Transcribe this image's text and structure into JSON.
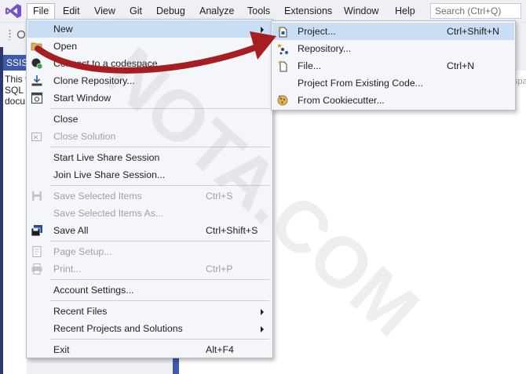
{
  "menubar": {
    "logo_icon": "visual-studio-logo-icon",
    "items": [
      "File",
      "Edit",
      "View",
      "Git",
      "Debug",
      "Analyze",
      "Tools",
      "Extensions",
      "Window",
      "Help"
    ],
    "search": {
      "placeholder": "Search (Ctrl+Q)"
    }
  },
  "toolbar": {
    "icon": "toolbar-back-icon"
  },
  "document": {
    "tab_label": "SSIS",
    "lines": [
      "This t",
      "SQL S",
      "docu"
    ],
    "right_fragment": "spa"
  },
  "file_menu": {
    "items": [
      {
        "label": "New",
        "shortcut": "",
        "icon": "",
        "submenu": true
      },
      {
        "label": "Open",
        "shortcut": "",
        "icon": "open-icon",
        "submenu": true
      },
      {
        "label": "Connect to a codespace",
        "shortcut": "",
        "icon": "codespace-icon"
      },
      {
        "label": "Clone Repository...",
        "shortcut": "",
        "icon": "clone-repository-icon"
      },
      {
        "label": "Start Window",
        "shortcut": "",
        "icon": "start-window-icon"
      },
      {
        "label": "Close",
        "shortcut": "",
        "icon": ""
      },
      {
        "label": "Close Solution",
        "shortcut": "",
        "icon": "close-solution-icon",
        "disabled": true
      },
      {
        "label": "Start Live Share Session",
        "shortcut": "",
        "icon": ""
      },
      {
        "label": "Join Live Share Session...",
        "shortcut": "",
        "icon": ""
      },
      {
        "label": "Save Selected Items",
        "shortcut": "Ctrl+S",
        "icon": "save-icon",
        "disabled": true
      },
      {
        "label": "Save Selected Items As...",
        "shortcut": "",
        "icon": "",
        "disabled": true
      },
      {
        "label": "Save All",
        "shortcut": "Ctrl+Shift+S",
        "icon": "save-all-icon"
      },
      {
        "label": "Page Setup...",
        "shortcut": "",
        "icon": "page-setup-icon",
        "disabled": true
      },
      {
        "label": "Print...",
        "shortcut": "Ctrl+P",
        "icon": "print-icon",
        "disabled": true
      },
      {
        "label": "Account Settings...",
        "shortcut": "",
        "icon": ""
      },
      {
        "label": "Recent Files",
        "shortcut": "",
        "icon": "",
        "submenu": true
      },
      {
        "label": "Recent Projects and Solutions",
        "shortcut": "",
        "icon": "",
        "submenu": true
      },
      {
        "label": "Exit",
        "shortcut": "Alt+F4",
        "icon": ""
      }
    ]
  },
  "new_submenu": {
    "items": [
      {
        "label": "Project...",
        "shortcut": "Ctrl+Shift+N",
        "icon": "new-project-icon"
      },
      {
        "label": "Repository...",
        "shortcut": "",
        "icon": "repository-icon"
      },
      {
        "label": "File...",
        "shortcut": "Ctrl+N",
        "icon": "new-file-icon"
      },
      {
        "label": "Project From Existing Code...",
        "shortcut": "",
        "icon": ""
      },
      {
        "label": "From Cookiecutter...",
        "shortcut": "",
        "icon": "cookiecutter-icon"
      }
    ]
  },
  "watermark": {
    "text": "NOTA.COM"
  },
  "colors": {
    "menubar_bg": "#eef0f5",
    "menu_bg": "#f5f6fa",
    "highlight": "#c9def5",
    "arrow": "#a61e22",
    "vs_purple": "#7b4fc9",
    "doc_tab": "#3e5aa8"
  }
}
